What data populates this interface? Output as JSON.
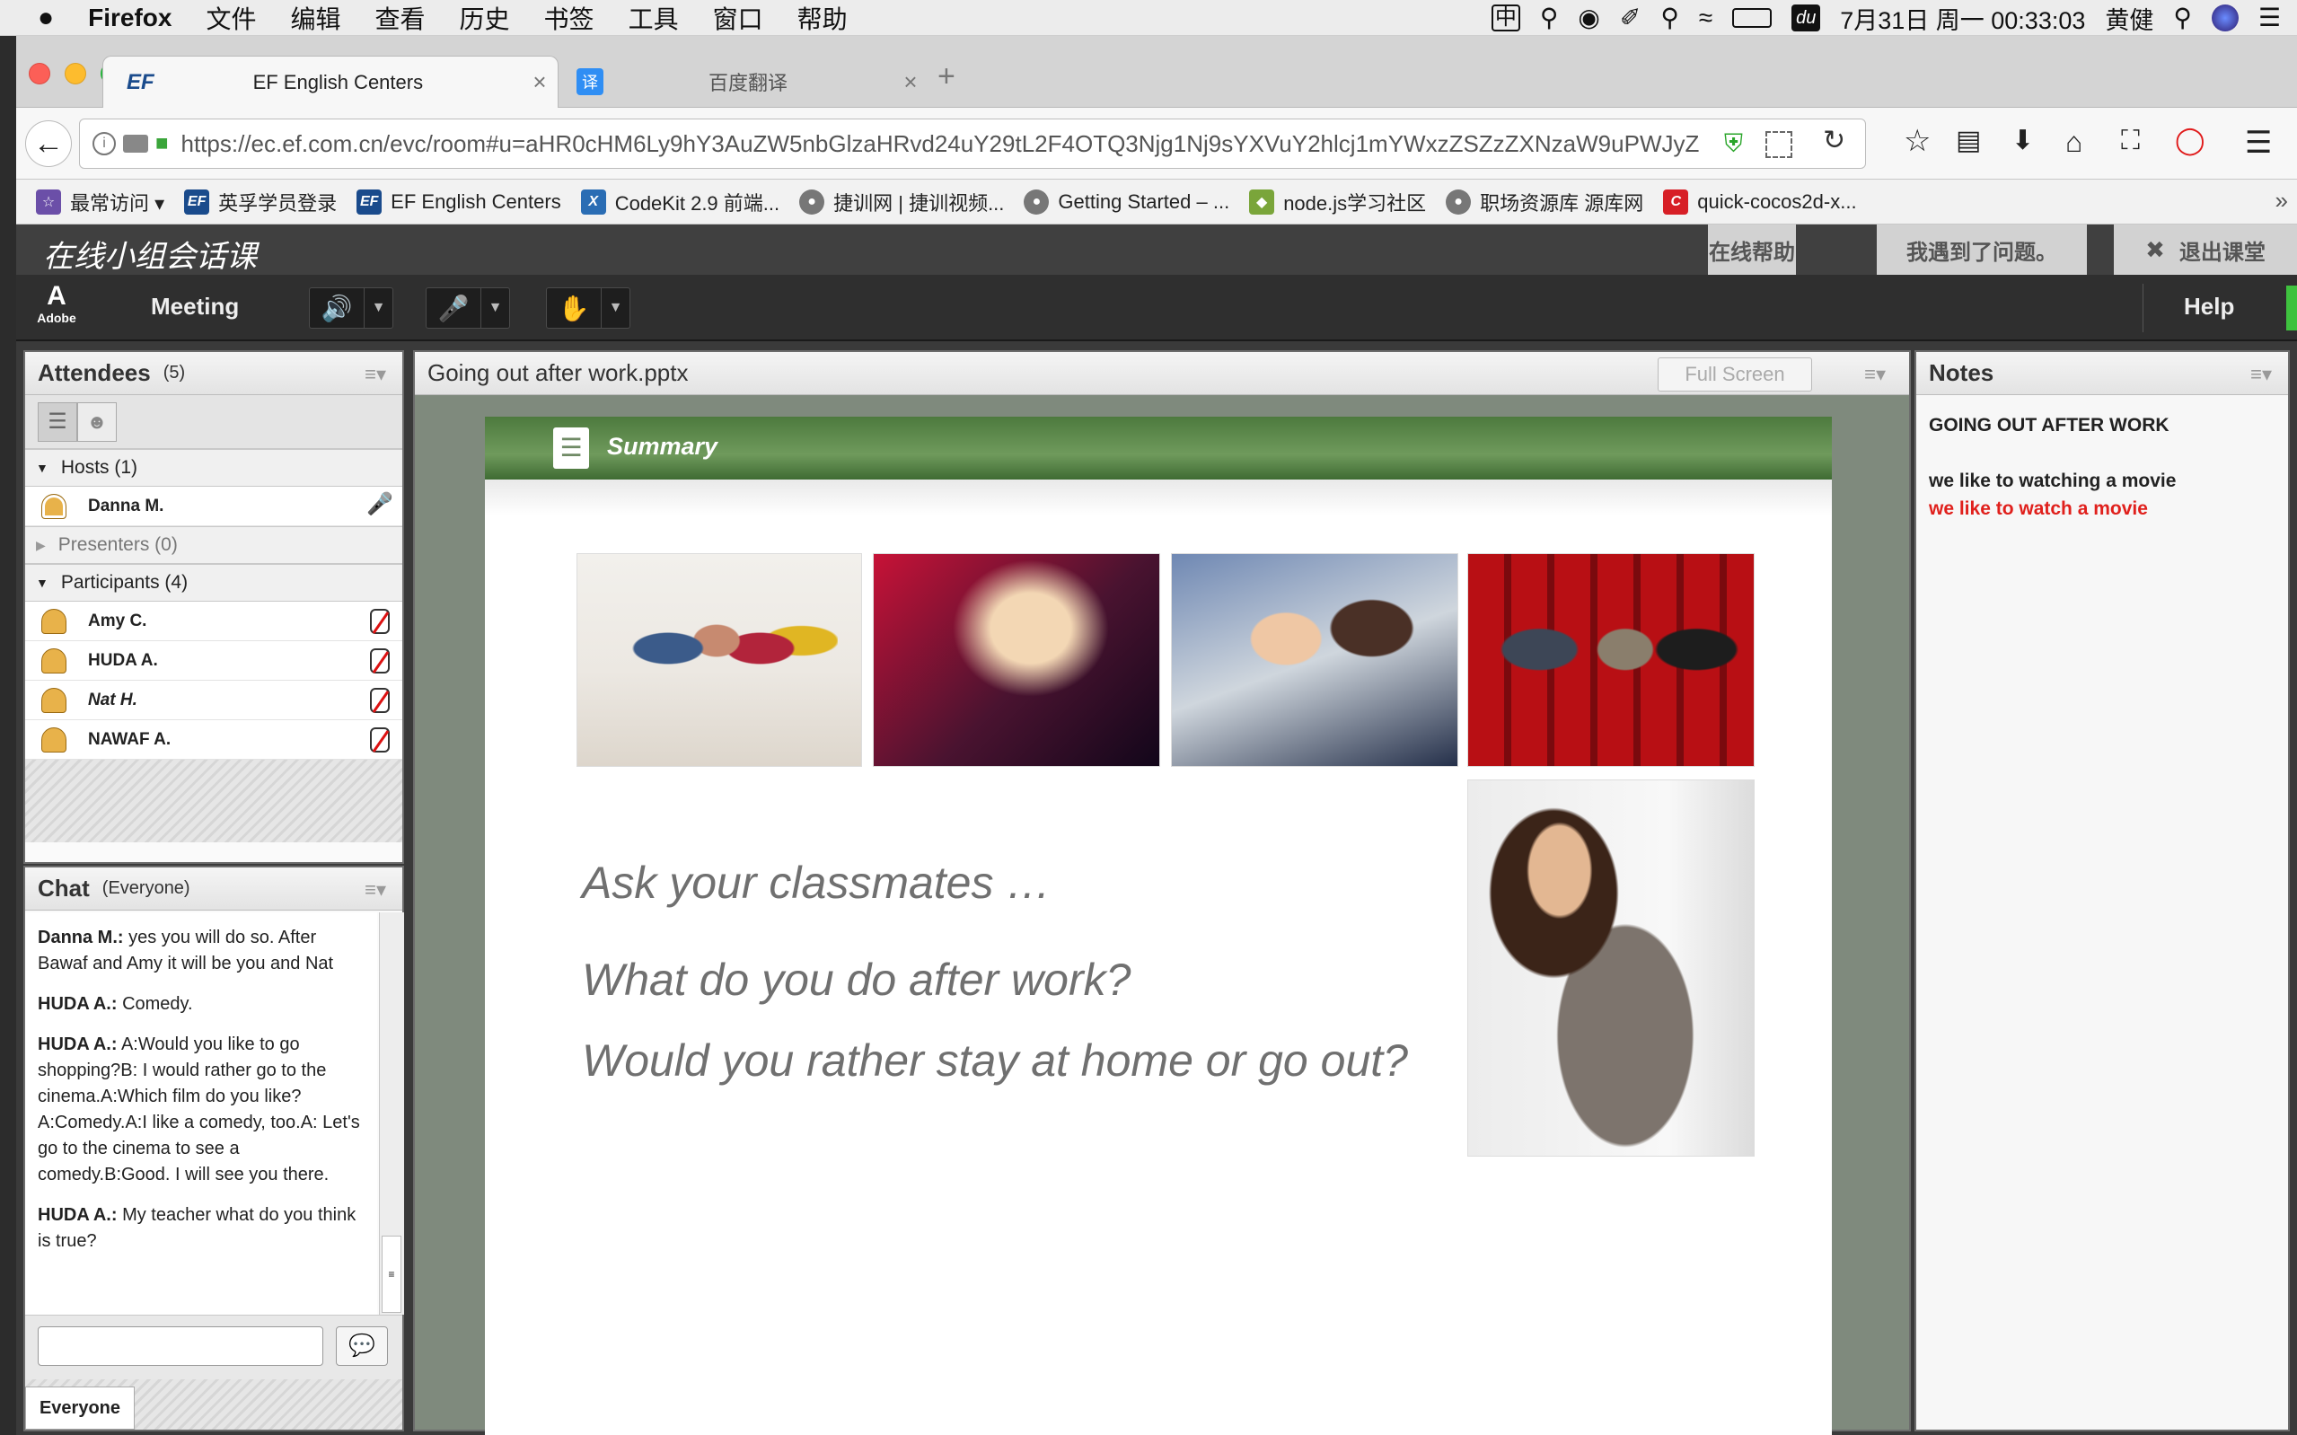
{
  "menubar": {
    "apple": "",
    "items": [
      "Firefox",
      "文件",
      "编辑",
      "查看",
      "历史",
      "书签",
      "工具",
      "窗口",
      "帮助"
    ],
    "clock": "7月31日 周一  00:33:03",
    "user": "黄健"
  },
  "browser": {
    "tabs": [
      {
        "icon": "EF",
        "label": "EF English Centers",
        "close": "×"
      },
      {
        "icon": "译",
        "label": "百度翻译",
        "close": "×"
      }
    ],
    "new_tab": "+",
    "url": "https://ec.ef.com.cn/evc/room#u=aHR0cHM6Ly9hY3AuZW5nbGlzaHRvd24uY29tL2F4OTQ3Njg1Nj9sYXVuY2hlcj1mYWxzZSZzZXNzaW9uPWJyZ",
    "bookmarks": [
      {
        "icon": "☆",
        "color": "#6b4fa8",
        "label": "最常访问 ▾"
      },
      {
        "icon": "EF",
        "color": "#1a4b8c",
        "label": "英孚学员登录"
      },
      {
        "icon": "EF",
        "color": "#1a4b8c",
        "label": "EF English Centers"
      },
      {
        "icon": "X",
        "color": "#2a6db4",
        "label": "CodeKit 2.9 前端..."
      },
      {
        "icon": "●",
        "color": "#777777",
        "label": "捷训网 | 捷训视频..."
      },
      {
        "icon": "●",
        "color": "#777777",
        "label": "Getting Started – ..."
      },
      {
        "icon": "◆",
        "color": "#7aa53a",
        "label": "node.js学习社区"
      },
      {
        "icon": "●",
        "color": "#777777",
        "label": "职场资源库 源库网"
      },
      {
        "icon": "C",
        "color": "#d71f26",
        "label": "quick-cocos2d-x..."
      }
    ],
    "more": "»"
  },
  "app": {
    "title": "在线小组会话课",
    "help_btn": "在线帮助",
    "problem_btn": "我遇到了问题。",
    "exit_btn": "退出课堂"
  },
  "toolbar": {
    "brand": "Adobe",
    "meeting": "Meeting",
    "help": "Help"
  },
  "attendees": {
    "title": "Attendees",
    "count": "(5)",
    "hosts_label": "Hosts (1)",
    "presenters_label": "Presenters (0)",
    "participants_label": "Participants (4)",
    "hosts": [
      "Danna M."
    ],
    "participants": [
      "Amy C.",
      "HUDA A.",
      "Nat H.",
      "NAWAF A."
    ]
  },
  "chat": {
    "title": "Chat",
    "scope": "(Everyone)",
    "messages": [
      {
        "author": "Danna M.:",
        "text": " yes you will do so. After Bawaf and Amy it will be you and Nat"
      },
      {
        "author": "HUDA A.:",
        "text": " Comedy."
      },
      {
        "author": "HUDA A.:",
        "text": " A:Would you like to go shopping?B: I would rather go to the cinema.A:Which film do you like?A:Comedy.A:I like a comedy, too.A: Let's go to the cinema to see a comedy.B:Good.  I will see you there."
      },
      {
        "author": "HUDA A.:",
        "text": " My teacher what do you think is true?"
      }
    ],
    "input_value": "",
    "recipient": "Everyone"
  },
  "share": {
    "title": "Going out after work.pptx",
    "fullscreen": "Full Screen",
    "slide_heading": "Summary",
    "questions": [
      "Ask your classmates …",
      "What do you do after work?",
      "Would you rather stay at home or go out?"
    ]
  },
  "notes": {
    "title": "Notes",
    "heading": "GOING OUT AFTER WORK",
    "line1": "we like to watching a movie",
    "line2": "we like to watch a movie",
    "correction_color": "#e0201c"
  }
}
